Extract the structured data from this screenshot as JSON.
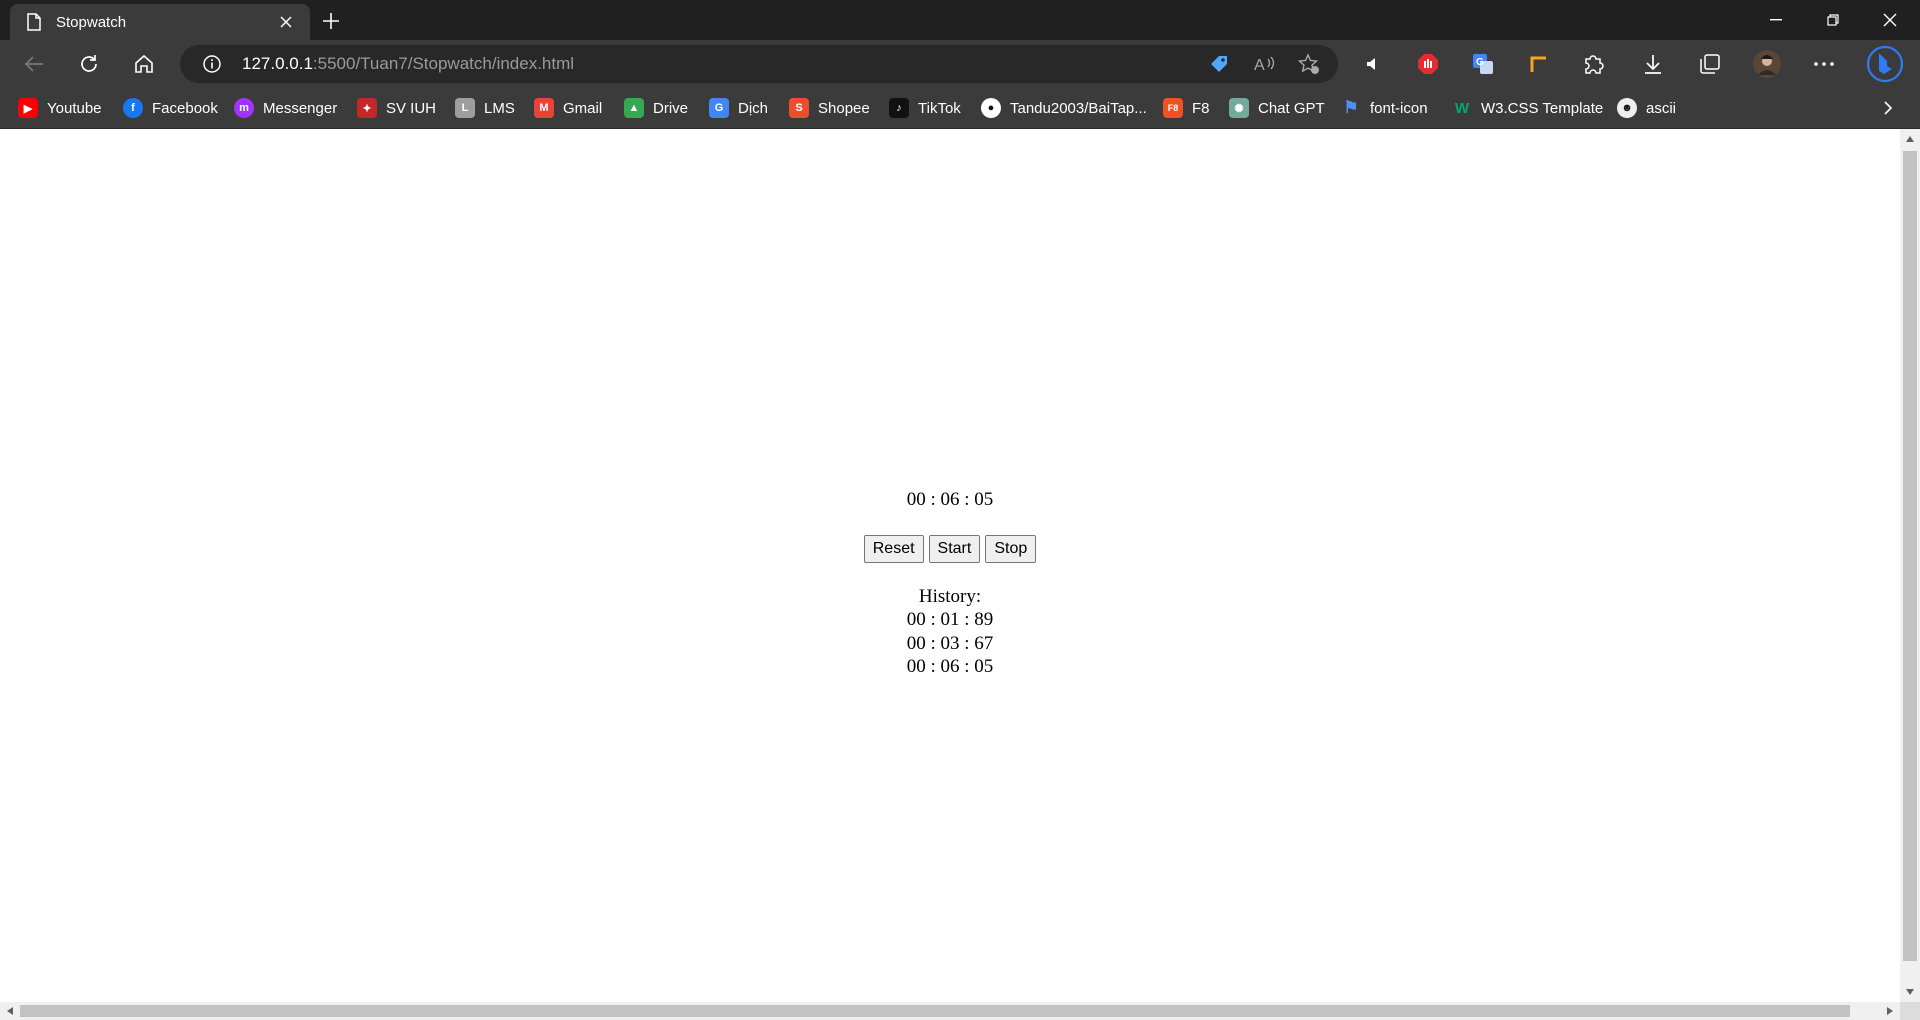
{
  "window": {
    "tab_title": "Stopwatch",
    "icons": {
      "page": "page-icon",
      "close": "close-icon",
      "new_tab": "plus-icon"
    },
    "controls": [
      "minimize-icon",
      "restore-icon",
      "close-icon"
    ]
  },
  "toolbar": {
    "url_host": "127.0.0.1",
    "url_path": ":5500/Tuan7/Stopwatch/index.html",
    "icons": [
      "back-icon",
      "reload-icon",
      "home-icon",
      "site-info-icon",
      "tag-icon",
      "read-aloud-icon",
      "add-favorite-icon",
      "extension-puzzle-icon",
      "downloads-icon",
      "collections-icon",
      "profile-avatar",
      "more-icon",
      "bing-icon"
    ]
  },
  "bookmarks": [
    {
      "label": "Youtube",
      "color": "#ff0000",
      "glyph": "▶"
    },
    {
      "label": "Facebook",
      "color": "#1877f2",
      "glyph": "f"
    },
    {
      "label": "Messenger",
      "color": "#a033ff",
      "glyph": "m"
    },
    {
      "label": "SV IUH",
      "color": "#c62828",
      "glyph": "✦"
    },
    {
      "label": "LMS",
      "color": "#9e9e9e",
      "glyph": "L"
    },
    {
      "label": "Gmail",
      "color": "#ea4335",
      "glyph": "M"
    },
    {
      "label": "Drive",
      "color": "#34a853",
      "glyph": "▲"
    },
    {
      "label": "Dịch",
      "color": "#4285f4",
      "glyph": "G"
    },
    {
      "label": "Shopee",
      "color": "#ee4d2d",
      "glyph": "S"
    },
    {
      "label": "TikTok",
      "color": "#111111",
      "glyph": "♪"
    },
    {
      "label": "Tandu2003/BaiTap...",
      "color": "#ffffff",
      "glyph": "●"
    },
    {
      "label": "F8",
      "color": "#f05123",
      "glyph": "F8"
    },
    {
      "label": "Chat GPT",
      "color": "#74aa9c",
      "glyph": "✺"
    },
    {
      "label": "font-icon",
      "color": "#4f8ef7",
      "glyph": "⚑"
    },
    {
      "label": "W3.CSS Template",
      "color": "#04aa6d",
      "glyph": "W"
    },
    {
      "label": "ascii",
      "color": "#eeeeee",
      "glyph": "☻"
    }
  ],
  "stopwatch": {
    "time": "00 : 06 : 05",
    "buttons": {
      "reset": "Reset",
      "start": "Start",
      "stop": "Stop"
    },
    "history_label": "History:",
    "history": [
      "00 : 01 : 89",
      "00 : 03 : 67",
      "00 : 06 : 05"
    ]
  }
}
